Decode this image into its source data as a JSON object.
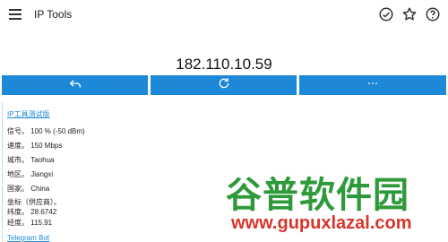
{
  "appbar": {
    "title": "IP Tools",
    "menu_icon": "menu-icon",
    "actions": [
      "check-badge-icon",
      "star-icon",
      "help-icon"
    ]
  },
  "ip": {
    "address": "182.110.10.59"
  },
  "buttons": [
    {
      "icon": "back-arrow-icon"
    },
    {
      "icon": "refresh-icon"
    },
    {
      "icon": "more-dots-icon"
    }
  ],
  "colors": {
    "accent": "#1e88d8",
    "watermark_green": "#2e9a3a",
    "watermark_red": "#d9342a"
  },
  "details": {
    "link_top": "IP工具测试版",
    "rows": [
      {
        "label": "信号。",
        "value": "100 % (-50 dBm)"
      },
      {
        "label": "速度。",
        "value": "150 Mbps"
      },
      {
        "label": "城市。",
        "value": "Taohua"
      },
      {
        "label": "地区。",
        "value": "Jiangxi"
      },
      {
        "label": "国家。",
        "value": "China"
      }
    ],
    "coords_label": "坐标（供应商）。",
    "lat_label": "纬度。",
    "lat_value": "28.6742",
    "lon_label": "经度。",
    "lon_value": "115.91",
    "link_bottom": "Telegram Bot"
  },
  "watermark": {
    "text": "谷普软件园",
    "url": "www.gupuxlazal.com"
  }
}
